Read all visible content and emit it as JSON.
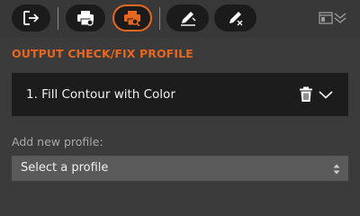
{
  "toolbar": {
    "buttons": [
      {
        "name": "exit-icon"
      },
      {
        "name": "print-check-icon"
      },
      {
        "name": "print-fix-icon",
        "active": true
      },
      {
        "name": "pen-edit-icon"
      },
      {
        "name": "pen-fix-icon"
      }
    ],
    "right_icons": [
      "panel-icon",
      "collapse-chevron-icon"
    ],
    "accent": "#e8671f"
  },
  "section": {
    "title": "OUTPUT CHECK/FIX PROFILE"
  },
  "profiles": [
    {
      "label": "1.  Fill Contour with Color"
    }
  ],
  "add_profile": {
    "label": "Add new profile:",
    "select_value": "Select a profile"
  }
}
